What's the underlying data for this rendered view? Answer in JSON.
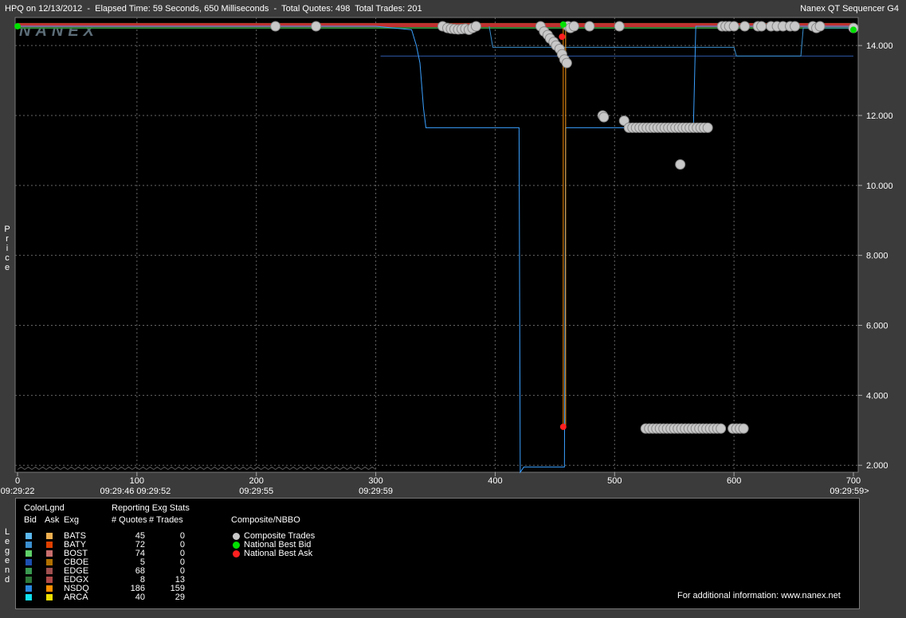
{
  "header": {
    "left": "HPQ on 12/13/2012  -  Elapsed Time: 59 Seconds, 650 Milliseconds  -  Total Quotes: 498  Total Trades: 201",
    "right": "Nanex QT Sequencer G4"
  },
  "watermark": "NANEX",
  "side_labels": {
    "price": "Price",
    "legend": "Legend"
  },
  "chart_data": {
    "type": "scatter",
    "ylabel": "Price",
    "ylim": [
      1.8,
      14.8
    ],
    "xlim": [
      0,
      700
    ],
    "y_ticks": [
      "2.000",
      "4.000",
      "6.000",
      "8.000",
      "10.000",
      "12.000",
      "14.000"
    ],
    "x_ticks": [
      {
        "value": 0,
        "label": "0",
        "time": "09:29:22"
      },
      {
        "value": 100,
        "label": "100",
        "time": "09:29:46  09:29:52"
      },
      {
        "value": 200,
        "label": "200",
        "time": "09:29:55"
      },
      {
        "value": 300,
        "label": "300",
        "time": "09:29:59"
      },
      {
        "value": 400,
        "label": "400",
        "time": ""
      },
      {
        "value": 500,
        "label": "500",
        "time": ""
      },
      {
        "value": 600,
        "label": "600",
        "time": ""
      },
      {
        "value": 700,
        "label": "700",
        "time": "09:29:59>"
      }
    ],
    "series": [
      {
        "name": "Composite Trades",
        "color": "#c8c8c8",
        "points": [
          [
            216,
            14.55
          ],
          [
            250,
            14.55
          ],
          [
            356,
            14.55
          ],
          [
            360,
            14.5
          ],
          [
            363,
            14.48
          ],
          [
            366,
            14.47
          ],
          [
            369,
            14.46
          ],
          [
            372,
            14.47
          ],
          [
            375,
            14.48
          ],
          [
            378,
            14.45
          ],
          [
            381,
            14.5
          ],
          [
            384,
            14.55
          ],
          [
            438,
            14.55
          ],
          [
            441,
            14.4
          ],
          [
            444,
            14.3
          ],
          [
            446,
            14.2
          ],
          [
            449,
            14.1
          ],
          [
            451,
            14.0
          ],
          [
            454,
            13.9
          ],
          [
            456,
            13.75
          ],
          [
            458,
            13.6
          ],
          [
            460,
            13.5
          ],
          [
            461,
            14.55
          ],
          [
            463,
            14.5
          ],
          [
            466,
            14.55
          ],
          [
            479,
            14.55
          ],
          [
            504,
            14.55
          ],
          [
            490,
            12.0
          ],
          [
            491,
            11.95
          ],
          [
            508,
            11.85
          ],
          [
            512,
            11.65
          ],
          [
            515,
            11.65
          ],
          [
            518,
            11.65
          ],
          [
            521,
            11.65
          ],
          [
            524,
            11.65
          ],
          [
            527,
            11.65
          ],
          [
            530,
            11.65
          ],
          [
            533,
            11.65
          ],
          [
            536,
            11.65
          ],
          [
            539,
            11.65
          ],
          [
            542,
            11.65
          ],
          [
            545,
            11.65
          ],
          [
            548,
            11.65
          ],
          [
            551,
            11.65
          ],
          [
            554,
            11.65
          ],
          [
            557,
            11.65
          ],
          [
            560,
            11.65
          ],
          [
            563,
            11.65
          ],
          [
            566,
            11.65
          ],
          [
            569,
            11.65
          ],
          [
            572,
            11.65
          ],
          [
            575,
            11.65
          ],
          [
            578,
            11.65
          ],
          [
            555,
            10.6
          ],
          [
            526,
            3.05
          ],
          [
            529,
            3.05
          ],
          [
            532,
            3.05
          ],
          [
            535,
            3.05
          ],
          [
            538,
            3.05
          ],
          [
            541,
            3.05
          ],
          [
            544,
            3.05
          ],
          [
            547,
            3.05
          ],
          [
            550,
            3.05
          ],
          [
            553,
            3.05
          ],
          [
            556,
            3.05
          ],
          [
            559,
            3.05
          ],
          [
            562,
            3.05
          ],
          [
            565,
            3.05
          ],
          [
            568,
            3.05
          ],
          [
            571,
            3.05
          ],
          [
            574,
            3.05
          ],
          [
            577,
            3.05
          ],
          [
            580,
            3.05
          ],
          [
            583,
            3.05
          ],
          [
            586,
            3.05
          ],
          [
            589,
            3.05
          ],
          [
            599,
            3.05
          ],
          [
            602,
            3.05
          ],
          [
            605,
            3.05
          ],
          [
            608,
            3.05
          ],
          [
            590,
            14.55
          ],
          [
            593,
            14.55
          ],
          [
            596,
            14.55
          ],
          [
            600,
            14.55
          ],
          [
            609,
            14.55
          ],
          [
            620,
            14.55
          ],
          [
            623,
            14.55
          ],
          [
            631,
            14.55
          ],
          [
            636,
            14.55
          ],
          [
            641,
            14.55
          ],
          [
            647,
            14.55
          ],
          [
            651,
            14.55
          ],
          [
            666,
            14.55
          ],
          [
            669,
            14.5
          ],
          [
            672,
            14.55
          ],
          [
            700,
            14.5
          ]
        ]
      },
      {
        "name": "National Best Bid",
        "color": "#00e000",
        "points": [
          [
            0,
            14.55
          ],
          [
            457,
            14.6
          ],
          [
            700,
            14.45
          ]
        ]
      },
      {
        "name": "National Best Ask",
        "color": "#ff2020",
        "points": [
          [
            456,
            14.25
          ],
          [
            457,
            3.1
          ]
        ]
      }
    ],
    "nsdq_bid_line": [
      [
        0,
        14.55
      ],
      [
        300,
        14.55
      ],
      [
        330,
        14.45
      ],
      [
        334,
        14.0
      ],
      [
        337,
        13.5
      ],
      [
        340,
        12.2
      ],
      [
        342,
        11.65
      ],
      [
        420,
        11.65
      ],
      [
        421,
        1.8
      ],
      [
        424,
        1.95
      ],
      [
        458,
        1.95
      ],
      [
        459,
        11.65
      ],
      [
        566,
        11.65
      ],
      [
        568,
        14.55
      ],
      [
        700,
        14.55
      ]
    ],
    "other_bid_line": [
      [
        395,
        14.55
      ],
      [
        398,
        13.95
      ],
      [
        600,
        13.95
      ],
      [
        602,
        13.7
      ],
      [
        656,
        13.7
      ],
      [
        658,
        14.5
      ],
      [
        700,
        14.5
      ]
    ],
    "arca_line": [
      [
        304,
        13.7
      ],
      [
        700,
        13.7
      ]
    ],
    "nsdq_ask_line": [
      [
        457,
        14.6
      ],
      [
        459,
        3.1
      ],
      [
        459,
        14.6
      ]
    ]
  },
  "legend": {
    "color_legend_title": "ColorLgnd",
    "stats_title": "Reporting Exg Stats",
    "col_bid": "Bid",
    "col_ask": "Ask",
    "col_exg": "Exg",
    "col_quotes": "# Quotes",
    "col_trades": "# Trades",
    "exchanges": [
      {
        "name": "BATS",
        "quotes": "45",
        "trades": "0",
        "bid_color": "#5bb8f0",
        "ask_color": "#f0b050"
      },
      {
        "name": "BATY",
        "quotes": "72",
        "trades": "0",
        "bid_color": "#3a8fd0",
        "ask_color": "#e04000"
      },
      {
        "name": "BOST",
        "quotes": "74",
        "trades": "0",
        "bid_color": "#5fd06a",
        "ask_color": "#c86e6e"
      },
      {
        "name": "CBOE",
        "quotes": "5",
        "trades": "0",
        "bid_color": "#1c4fb0",
        "ask_color": "#b07000"
      },
      {
        "name": "EDGE",
        "quotes": "68",
        "trades": "0",
        "bid_color": "#3a9a50",
        "ask_color": "#a05050"
      },
      {
        "name": "EDGX",
        "quotes": "8",
        "trades": "13",
        "bid_color": "#2e7a3a",
        "ask_color": "#b04a4a"
      },
      {
        "name": "NSDQ",
        "quotes": "186",
        "trades": "159",
        "bid_color": "#2a88e0",
        "ask_color": "#ff9000"
      },
      {
        "name": "ARCA",
        "quotes": "40",
        "trades": "29",
        "bid_color": "#10e0f0",
        "ask_color": "#f0e000"
      }
    ],
    "composite_title": "Composite/NBBO",
    "composite_items": [
      {
        "label": "Composite Trades",
        "color": "#c8c8c8"
      },
      {
        "label": "National Best Bid",
        "color": "#00e000"
      },
      {
        "label": "National Best Ask",
        "color": "#ff2020"
      }
    ],
    "info": "For additional information: www.nanex.net"
  }
}
